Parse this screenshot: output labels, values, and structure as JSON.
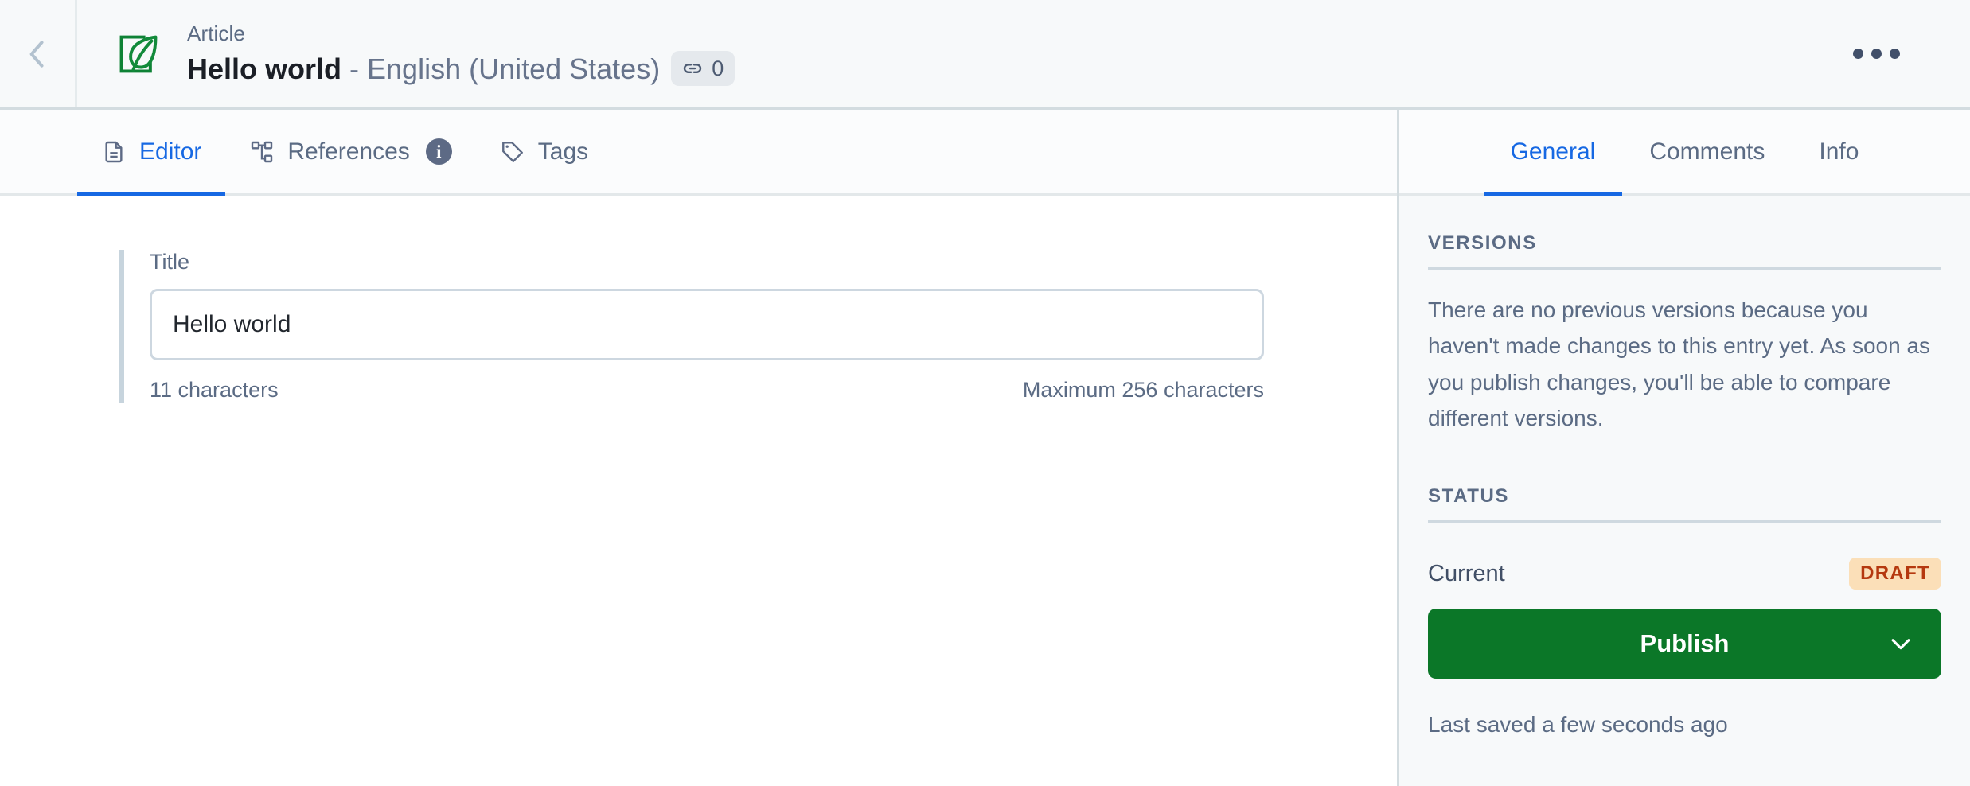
{
  "header": {
    "back_icon": "chevron-left-icon",
    "entry_icon": "article-leaf-icon",
    "kicker": "Article",
    "title_name": "Hello world",
    "title_separator": " - ",
    "title_locale": "English (United States)",
    "link_icon": "link-chain-icon",
    "link_count": "0",
    "actions_icon": "more-horizontal-icon"
  },
  "editor_tabs": [
    {
      "label": "Editor",
      "icon": "document-icon",
      "active": true
    },
    {
      "label": "References",
      "icon": "sitemap-icon",
      "active": false,
      "info_icon": "info-circle-icon",
      "info_glyph": "i"
    },
    {
      "label": "Tags",
      "icon": "tag-icon",
      "active": false
    }
  ],
  "editor": {
    "field_label": "Title",
    "field_value": "Hello world",
    "field_placeholder": "Title",
    "char_count": "11 characters",
    "char_max": "Maximum 256 characters"
  },
  "panel": {
    "tabs": [
      {
        "label": "General",
        "active": true
      },
      {
        "label": "Comments",
        "active": false
      },
      {
        "label": "Info",
        "active": false
      }
    ],
    "versions": {
      "heading": "VERSIONS",
      "text": "There are no previous versions because you haven't made changes to this entry yet. As soon as you publish changes, you'll be able to compare different versions."
    },
    "status": {
      "heading": "STATUS",
      "current_label": "Current",
      "badge": "DRAFT",
      "publish_label": "Publish",
      "publish_chevron_icon": "chevron-down-icon",
      "saved_text": "Last saved a few seconds ago"
    }
  },
  "colors": {
    "accent_blue": "#1668e3",
    "publish_green": "#0b7728",
    "brand_green": "#13893b",
    "draft_badge_bg": "#fbdfb8",
    "draft_badge_text": "#b5380f",
    "panel_bg": "#f7f9fa",
    "muted_text": "#5b6b84"
  }
}
